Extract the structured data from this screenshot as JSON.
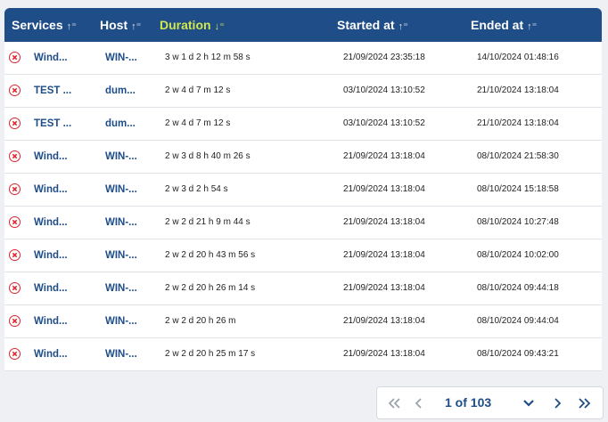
{
  "table": {
    "columns": [
      {
        "label": "Services",
        "sort": "↑⁼"
      },
      {
        "label": "Host",
        "sort": "↑⁼"
      },
      {
        "label": "Duration",
        "sort": "↓⁼"
      },
      {
        "label": "Started at",
        "sort": "↑⁼"
      },
      {
        "label": "Ended at",
        "sort": "↑⁼"
      }
    ],
    "rows": [
      {
        "service": "Wind...",
        "host": "WIN-...",
        "duration": "3 w 1 d 2 h 12 m 58 s",
        "started": "21/09/2024 23:35:18",
        "ended": "14/10/2024 01:48:16"
      },
      {
        "service": "TEST ...",
        "host": "dum...",
        "duration": "2 w 4 d 7 m 12 s",
        "started": "03/10/2024 13:10:52",
        "ended": "21/10/2024 13:18:04"
      },
      {
        "service": "TEST ...",
        "host": "dum...",
        "duration": "2 w 4 d 7 m 12 s",
        "started": "03/10/2024 13:10:52",
        "ended": "21/10/2024 13:18:04"
      },
      {
        "service": "Wind...",
        "host": "WIN-...",
        "duration": "2 w 3 d 8 h 40 m 26 s",
        "started": "21/09/2024 13:18:04",
        "ended": "08/10/2024 21:58:30"
      },
      {
        "service": "Wind...",
        "host": "WIN-...",
        "duration": "2 w 3 d 2 h 54 s",
        "started": "21/09/2024 13:18:04",
        "ended": "08/10/2024 15:18:58"
      },
      {
        "service": "Wind...",
        "host": "WIN-...",
        "duration": "2 w 2 d 21 h 9 m 44 s",
        "started": "21/09/2024 13:18:04",
        "ended": "08/10/2024 10:27:48"
      },
      {
        "service": "Wind...",
        "host": "WIN-...",
        "duration": "2 w 2 d 20 h 43 m 56 s",
        "started": "21/09/2024 13:18:04",
        "ended": "08/10/2024 10:02:00"
      },
      {
        "service": "Wind...",
        "host": "WIN-...",
        "duration": "2 w 2 d 20 h 26 m 14 s",
        "started": "21/09/2024 13:18:04",
        "ended": "08/10/2024 09:44:18"
      },
      {
        "service": "Wind...",
        "host": "WIN-...",
        "duration": "2 w 2 d 20 h 26 m",
        "started": "21/09/2024 13:18:04",
        "ended": "08/10/2024 09:44:04"
      },
      {
        "service": "Wind...",
        "host": "WIN-...",
        "duration": "2 w 2 d 20 h 25 m 17 s",
        "started": "21/09/2024 13:18:04",
        "ended": "08/10/2024 09:43:21"
      }
    ]
  },
  "pagination": {
    "label": "1 of 103"
  },
  "icons": {
    "status": "error-circle-x-icon",
    "first": "double-chevron-left-icon",
    "prev": "chevron-left-icon",
    "dropdown": "chevron-down-icon",
    "next": "chevron-right-icon",
    "last": "double-chevron-right-icon"
  },
  "colors": {
    "header_bg": "#1e4d87",
    "active_sort": "#d4e64f",
    "link": "#1e4d87",
    "error": "#e0242c"
  }
}
